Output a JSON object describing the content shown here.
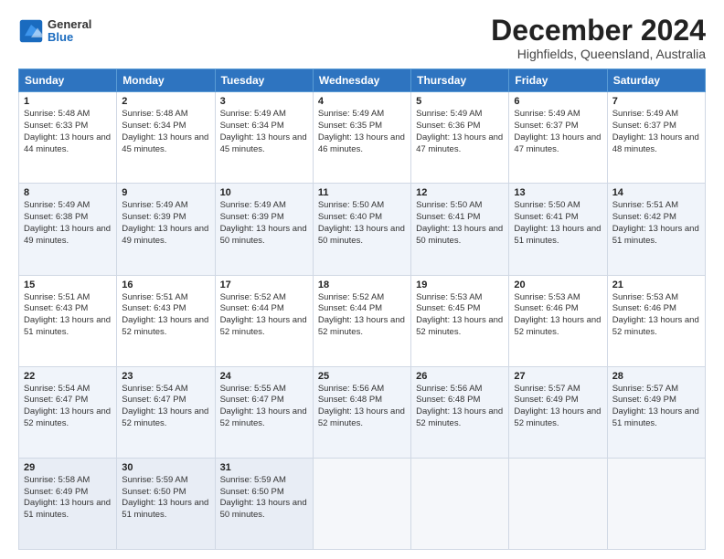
{
  "logo": {
    "general": "General",
    "blue": "Blue"
  },
  "title": {
    "month": "December 2024",
    "location": "Highfields, Queensland, Australia"
  },
  "calendar": {
    "headers": [
      "Sunday",
      "Monday",
      "Tuesday",
      "Wednesday",
      "Thursday",
      "Friday",
      "Saturday"
    ],
    "weeks": [
      [
        {
          "day": "1",
          "sunrise": "5:48 AM",
          "sunset": "6:33 PM",
          "daylight": "13 hours and 44 minutes."
        },
        {
          "day": "2",
          "sunrise": "5:48 AM",
          "sunset": "6:34 PM",
          "daylight": "13 hours and 45 minutes."
        },
        {
          "day": "3",
          "sunrise": "5:49 AM",
          "sunset": "6:34 PM",
          "daylight": "13 hours and 45 minutes."
        },
        {
          "day": "4",
          "sunrise": "5:49 AM",
          "sunset": "6:35 PM",
          "daylight": "13 hours and 46 minutes."
        },
        {
          "day": "5",
          "sunrise": "5:49 AM",
          "sunset": "6:36 PM",
          "daylight": "13 hours and 47 minutes."
        },
        {
          "day": "6",
          "sunrise": "5:49 AM",
          "sunset": "6:37 PM",
          "daylight": "13 hours and 47 minutes."
        },
        {
          "day": "7",
          "sunrise": "5:49 AM",
          "sunset": "6:37 PM",
          "daylight": "13 hours and 48 minutes."
        }
      ],
      [
        {
          "day": "8",
          "sunrise": "5:49 AM",
          "sunset": "6:38 PM",
          "daylight": "13 hours and 49 minutes."
        },
        {
          "day": "9",
          "sunrise": "5:49 AM",
          "sunset": "6:39 PM",
          "daylight": "13 hours and 49 minutes."
        },
        {
          "day": "10",
          "sunrise": "5:49 AM",
          "sunset": "6:39 PM",
          "daylight": "13 hours and 50 minutes."
        },
        {
          "day": "11",
          "sunrise": "5:50 AM",
          "sunset": "6:40 PM",
          "daylight": "13 hours and 50 minutes."
        },
        {
          "day": "12",
          "sunrise": "5:50 AM",
          "sunset": "6:41 PM",
          "daylight": "13 hours and 50 minutes."
        },
        {
          "day": "13",
          "sunrise": "5:50 AM",
          "sunset": "6:41 PM",
          "daylight": "13 hours and 51 minutes."
        },
        {
          "day": "14",
          "sunrise": "5:51 AM",
          "sunset": "6:42 PM",
          "daylight": "13 hours and 51 minutes."
        }
      ],
      [
        {
          "day": "15",
          "sunrise": "5:51 AM",
          "sunset": "6:43 PM",
          "daylight": "13 hours and 51 minutes."
        },
        {
          "day": "16",
          "sunrise": "5:51 AM",
          "sunset": "6:43 PM",
          "daylight": "13 hours and 52 minutes."
        },
        {
          "day": "17",
          "sunrise": "5:52 AM",
          "sunset": "6:44 PM",
          "daylight": "13 hours and 52 minutes."
        },
        {
          "day": "18",
          "sunrise": "5:52 AM",
          "sunset": "6:44 PM",
          "daylight": "13 hours and 52 minutes."
        },
        {
          "day": "19",
          "sunrise": "5:53 AM",
          "sunset": "6:45 PM",
          "daylight": "13 hours and 52 minutes."
        },
        {
          "day": "20",
          "sunrise": "5:53 AM",
          "sunset": "6:46 PM",
          "daylight": "13 hours and 52 minutes."
        },
        {
          "day": "21",
          "sunrise": "5:53 AM",
          "sunset": "6:46 PM",
          "daylight": "13 hours and 52 minutes."
        }
      ],
      [
        {
          "day": "22",
          "sunrise": "5:54 AM",
          "sunset": "6:47 PM",
          "daylight": "13 hours and 52 minutes."
        },
        {
          "day": "23",
          "sunrise": "5:54 AM",
          "sunset": "6:47 PM",
          "daylight": "13 hours and 52 minutes."
        },
        {
          "day": "24",
          "sunrise": "5:55 AM",
          "sunset": "6:47 PM",
          "daylight": "13 hours and 52 minutes."
        },
        {
          "day": "25",
          "sunrise": "5:56 AM",
          "sunset": "6:48 PM",
          "daylight": "13 hours and 52 minutes."
        },
        {
          "day": "26",
          "sunrise": "5:56 AM",
          "sunset": "6:48 PM",
          "daylight": "13 hours and 52 minutes."
        },
        {
          "day": "27",
          "sunrise": "5:57 AM",
          "sunset": "6:49 PM",
          "daylight": "13 hours and 52 minutes."
        },
        {
          "day": "28",
          "sunrise": "5:57 AM",
          "sunset": "6:49 PM",
          "daylight": "13 hours and 51 minutes."
        }
      ],
      [
        {
          "day": "29",
          "sunrise": "5:58 AM",
          "sunset": "6:49 PM",
          "daylight": "13 hours and 51 minutes."
        },
        {
          "day": "30",
          "sunrise": "5:59 AM",
          "sunset": "6:50 PM",
          "daylight": "13 hours and 51 minutes."
        },
        {
          "day": "31",
          "sunrise": "5:59 AM",
          "sunset": "6:50 PM",
          "daylight": "13 hours and 50 minutes."
        },
        null,
        null,
        null,
        null
      ]
    ]
  }
}
